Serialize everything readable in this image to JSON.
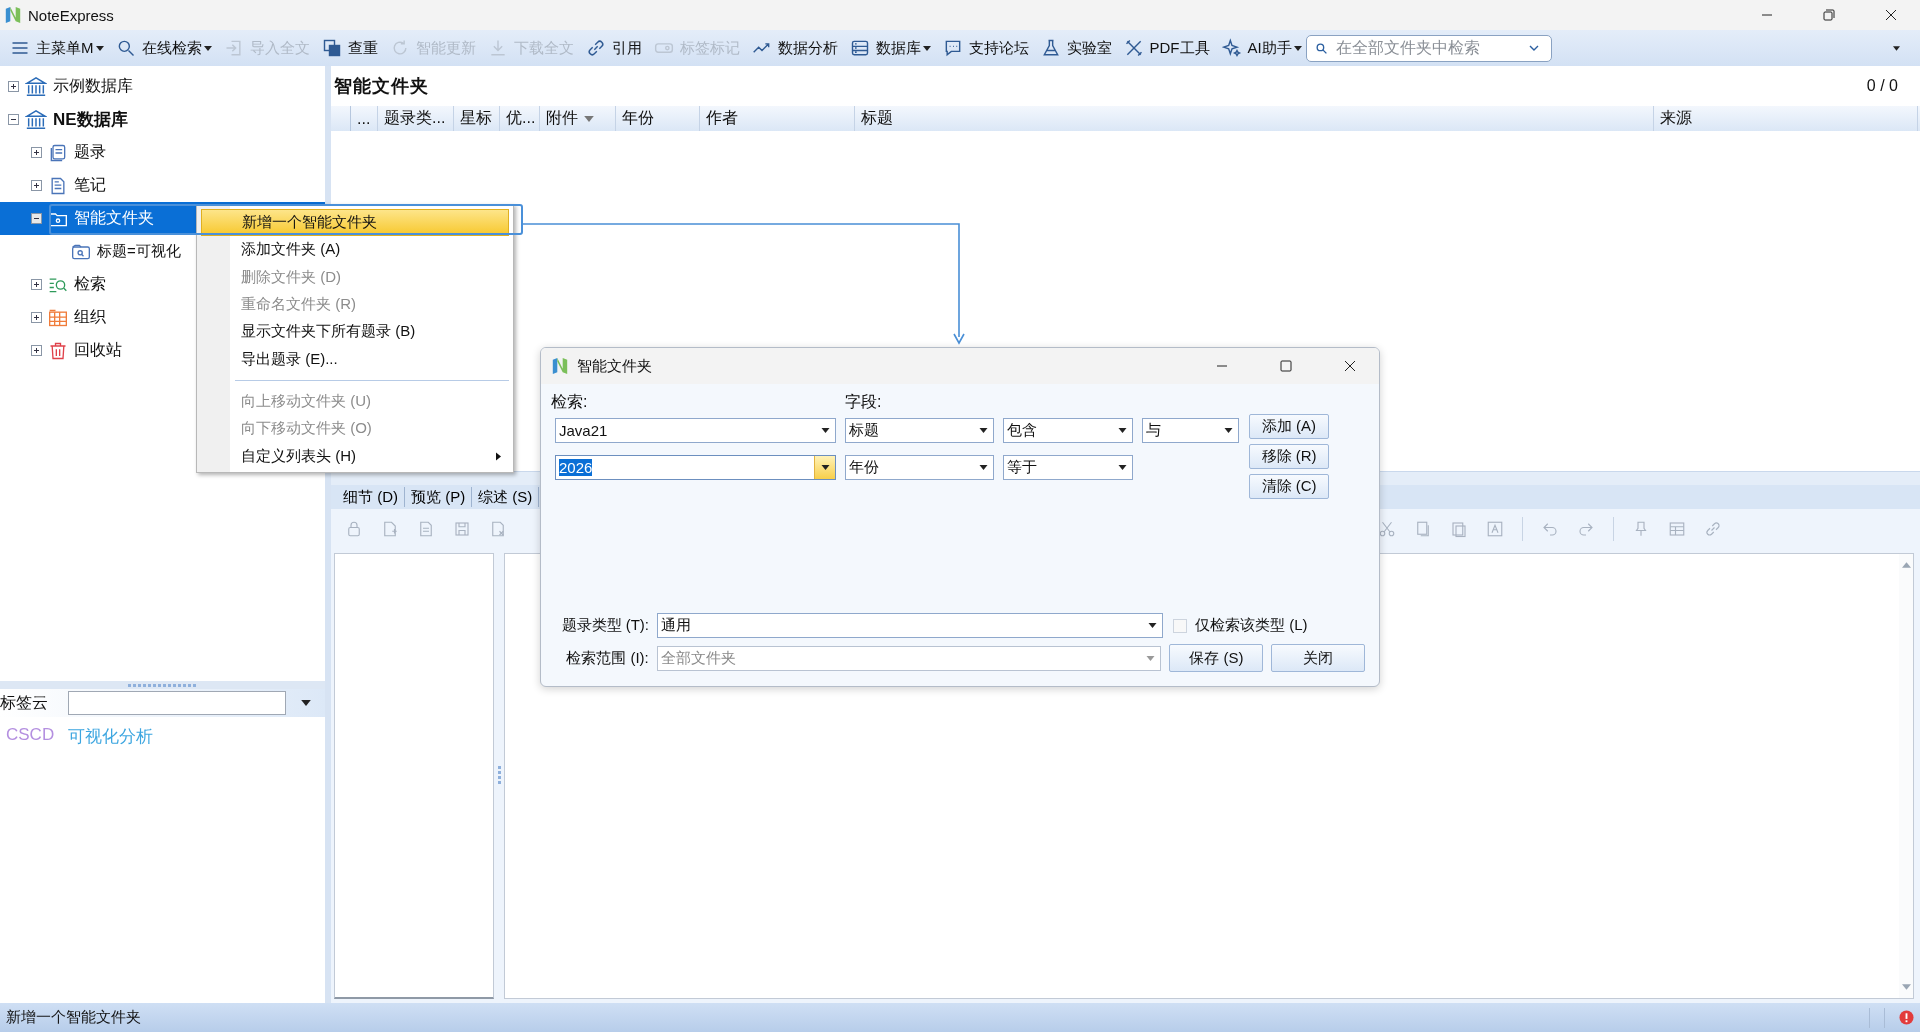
{
  "window": {
    "title": "NoteExpress"
  },
  "toolbar": {
    "items": [
      {
        "label": "主菜单M",
        "kind": "menu",
        "disabled": false,
        "dropdown": true
      },
      {
        "label": "在线检索",
        "kind": "search",
        "disabled": false,
        "dropdown": true
      },
      {
        "label": "导入全文",
        "kind": "import",
        "disabled": true,
        "dropdown": false
      },
      {
        "label": "查重",
        "kind": "duplicate",
        "disabled": false,
        "dropdown": false
      },
      {
        "label": "智能更新",
        "kind": "refresh",
        "disabled": true,
        "dropdown": false
      },
      {
        "label": "下载全文",
        "kind": "download",
        "disabled": true,
        "dropdown": false
      },
      {
        "label": "引用",
        "kind": "link",
        "disabled": false,
        "dropdown": false
      },
      {
        "label": "标签标记",
        "kind": "tag",
        "disabled": true,
        "dropdown": false
      },
      {
        "label": "数据分析",
        "kind": "chart",
        "disabled": false,
        "dropdown": false
      },
      {
        "label": "数据库",
        "kind": "database",
        "disabled": false,
        "dropdown": true
      },
      {
        "label": "支持论坛",
        "kind": "chat",
        "disabled": false,
        "dropdown": false
      },
      {
        "label": "实验室",
        "kind": "flask",
        "disabled": false,
        "dropdown": false
      },
      {
        "label": "PDF工具",
        "kind": "tools",
        "disabled": false,
        "dropdown": false
      },
      {
        "label": "AI助手",
        "kind": "sparkle",
        "disabled": false,
        "dropdown": true
      }
    ],
    "search": {
      "placeholder": "在全部文件夹中检索"
    }
  },
  "tree": [
    {
      "label": "示例数据库",
      "kind": "library",
      "bold": false,
      "expanded": false,
      "selected": false
    },
    {
      "label": "NE数据库",
      "kind": "library",
      "bold": true,
      "expanded": true,
      "selected": false,
      "children": [
        {
          "label": "题录",
          "kind": "records",
          "bold": false,
          "expanded": false,
          "selected": false
        },
        {
          "label": "笔记",
          "kind": "note",
          "bold": false,
          "expanded": false,
          "selected": false
        },
        {
          "label": "智能文件夹",
          "kind": "smart-folder",
          "bold": false,
          "expanded": true,
          "selected": true,
          "children": [
            {
              "label": "标题=可视化",
              "kind": "search-folder",
              "bold": false,
              "selected": false
            }
          ]
        },
        {
          "label": "检索",
          "kind": "search",
          "bold": false,
          "expanded": false,
          "selected": false
        },
        {
          "label": "组织",
          "kind": "organize",
          "bold": false,
          "expanded": false,
          "selected": false
        },
        {
          "label": "回收站",
          "kind": "trash",
          "bold": false,
          "expanded": false,
          "selected": false
        }
      ]
    }
  ],
  "tag_cloud": {
    "label": "标签云",
    "tags": [
      {
        "label": "CSCD",
        "color": "#b48fe0"
      },
      {
        "label": "可视化分析",
        "color": "#3da6e0"
      }
    ]
  },
  "list": {
    "title": "智能文件夹",
    "count": "0 / 0",
    "columns": [
      {
        "label": "...",
        "dropdown": false
      },
      {
        "label": "题录类...",
        "dropdown": false
      },
      {
        "label": "星标",
        "dropdown": false
      },
      {
        "label": "优...",
        "dropdown": false
      },
      {
        "label": "附件",
        "dropdown": true
      },
      {
        "label": "年份",
        "dropdown": false
      },
      {
        "label": "作者",
        "dropdown": false
      },
      {
        "label": "标题",
        "dropdown": false
      },
      {
        "label": "来源",
        "dropdown": false
      }
    ]
  },
  "detail_tabs": [
    {
      "label": "细节 (D)"
    },
    {
      "label": "预览 (P)"
    },
    {
      "label": "综述 (S)"
    }
  ],
  "context_menu": {
    "items": [
      {
        "kind": "item",
        "label": "新增一个智能文件夹",
        "disabled": false,
        "selected": true,
        "submenu": false
      },
      {
        "kind": "item",
        "label": "添加文件夹 (A)",
        "disabled": false,
        "selected": false,
        "submenu": false
      },
      {
        "kind": "item",
        "label": "删除文件夹 (D)",
        "disabled": true,
        "selected": false,
        "submenu": false
      },
      {
        "kind": "item",
        "label": "重命名文件夹 (R)",
        "disabled": true,
        "selected": false,
        "submenu": false
      },
      {
        "kind": "item",
        "label": "显示文件夹下所有题录 (B)",
        "disabled": false,
        "selected": false,
        "submenu": false
      },
      {
        "kind": "item",
        "label": "导出题录 (E)...",
        "disabled": false,
        "selected": false,
        "submenu": false
      },
      {
        "kind": "separator"
      },
      {
        "kind": "item",
        "label": "向上移动文件夹 (U)",
        "disabled": true,
        "selected": false,
        "submenu": false
      },
      {
        "kind": "item",
        "label": "向下移动文件夹 (O)",
        "disabled": true,
        "selected": false,
        "submenu": false
      },
      {
        "kind": "item",
        "label": "自定义列表头 (H)",
        "disabled": false,
        "selected": false,
        "submenu": true
      }
    ]
  },
  "dialog": {
    "title": "智能文件夹",
    "search_label": "检索:",
    "field_label": "字段:",
    "rows": [
      {
        "value": "Java21",
        "value_selected": false,
        "focused": false,
        "field": "标题",
        "operator": "包含",
        "connector": "与"
      },
      {
        "value": "2026",
        "value_selected": true,
        "focused": true,
        "field": "年份",
        "operator": "等于"
      }
    ],
    "buttons": [
      "添加 (A)",
      "移除 (R)",
      "清除 (C)"
    ],
    "record_type": {
      "label": "题录类型 (T):",
      "value": "通用"
    },
    "only_this_type": {
      "label": "仅检索该类型 (L)",
      "checked": false
    },
    "scope": {
      "label": "检索范围 (I):",
      "value": "全部文件夹",
      "disabled": true
    },
    "save": "保存 (S)",
    "close": "关闭"
  },
  "status_bar": {
    "text": "新增一个智能文件夹"
  }
}
